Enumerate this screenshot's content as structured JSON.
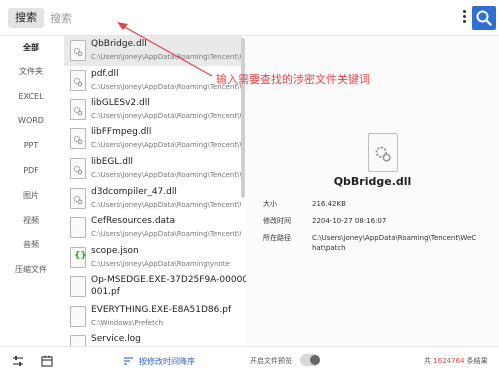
{
  "search": {
    "button_label": "搜索",
    "placeholder": "搜索",
    "value": ""
  },
  "sidebar": {
    "items": [
      {
        "label": "全部",
        "active": true
      },
      {
        "label": "文件夹"
      },
      {
        "label": "EXCEL"
      },
      {
        "label": "WORD"
      },
      {
        "label": "PPT"
      },
      {
        "label": "PDF"
      },
      {
        "label": "图片"
      },
      {
        "label": "视频"
      },
      {
        "label": "音频"
      },
      {
        "label": "压缩文件"
      }
    ]
  },
  "files": [
    {
      "name": "QbBridge.dll",
      "path": "C:\\Users\\joney\\AppData\\Roaming\\Tencent\\WeChat\\patch",
      "icon": "gear-file-icon",
      "selected": true
    },
    {
      "name": "pdf.dll",
      "path": "C:\\Users\\joney\\AppData\\Roaming\\Tencent\\WeChat\\patch",
      "icon": "gear-file-icon"
    },
    {
      "name": "libGLESv2.dll",
      "path": "C:\\Users\\joney\\AppData\\Roaming\\Tencent\\WeChat\\patch",
      "icon": "gear-file-icon"
    },
    {
      "name": "libFFmpeg.dll",
      "path": "C:\\Users\\joney\\AppData\\Roaming\\Tencent\\WeChat\\patch",
      "icon": "gear-file-icon"
    },
    {
      "name": "libEGL.dll",
      "path": "C:\\Users\\joney\\AppData\\Roaming\\Tencent\\WeChat\\patch",
      "icon": "gear-file-icon"
    },
    {
      "name": "d3dcompiler_47.dll",
      "path": "C:\\Users\\joney\\AppData\\Roaming\\Tencent\\WeChat\\patch",
      "icon": "gear-file-icon"
    },
    {
      "name": "CefResources.data",
      "path": "C:\\Users\\joney\\AppData\\Roaming\\Tencent\\WeChat\\patch",
      "icon": "blank-file-icon"
    },
    {
      "name": "scope.json",
      "path": "C:\\Users\\joney\\AppData\\Roaming\\ynote",
      "icon": "json-file-icon"
    },
    {
      "name": "Op-MSEDGE.EXE-37D25F9A-00000",
      "path": "001.pf",
      "icon": "blank-file-icon",
      "path_dark": true
    },
    {
      "name": "EVERYTHING.EXE-E8A51D86.pf",
      "path": "C:\\Windows\\Prefetch",
      "icon": "blank-file-icon"
    },
    {
      "name": "Service.log",
      "path": "",
      "icon": "blank-file-icon"
    }
  ],
  "annotation": {
    "text": "输入需要查找的涉密文件关键词"
  },
  "detail": {
    "name": "QbBridge.dll",
    "size_label": "大小",
    "size_value": "216.42KB",
    "modified_label": "修改时间",
    "modified_value": "2204-10-27 08:16:07",
    "path_label": "所在路径",
    "path_value": "C:\\Users\\joney\\AppData\\Roaming\\Tencent\\WeC hat\\patch"
  },
  "bottom": {
    "sort_label": "按修改时间降序",
    "preview_label": "开启文件预览",
    "preview_on": true,
    "count_prefix": "共",
    "count_value": "1624764",
    "count_suffix": "条结果"
  },
  "colors": {
    "accent": "#2f6fd1",
    "annotation": "#e0474c"
  }
}
